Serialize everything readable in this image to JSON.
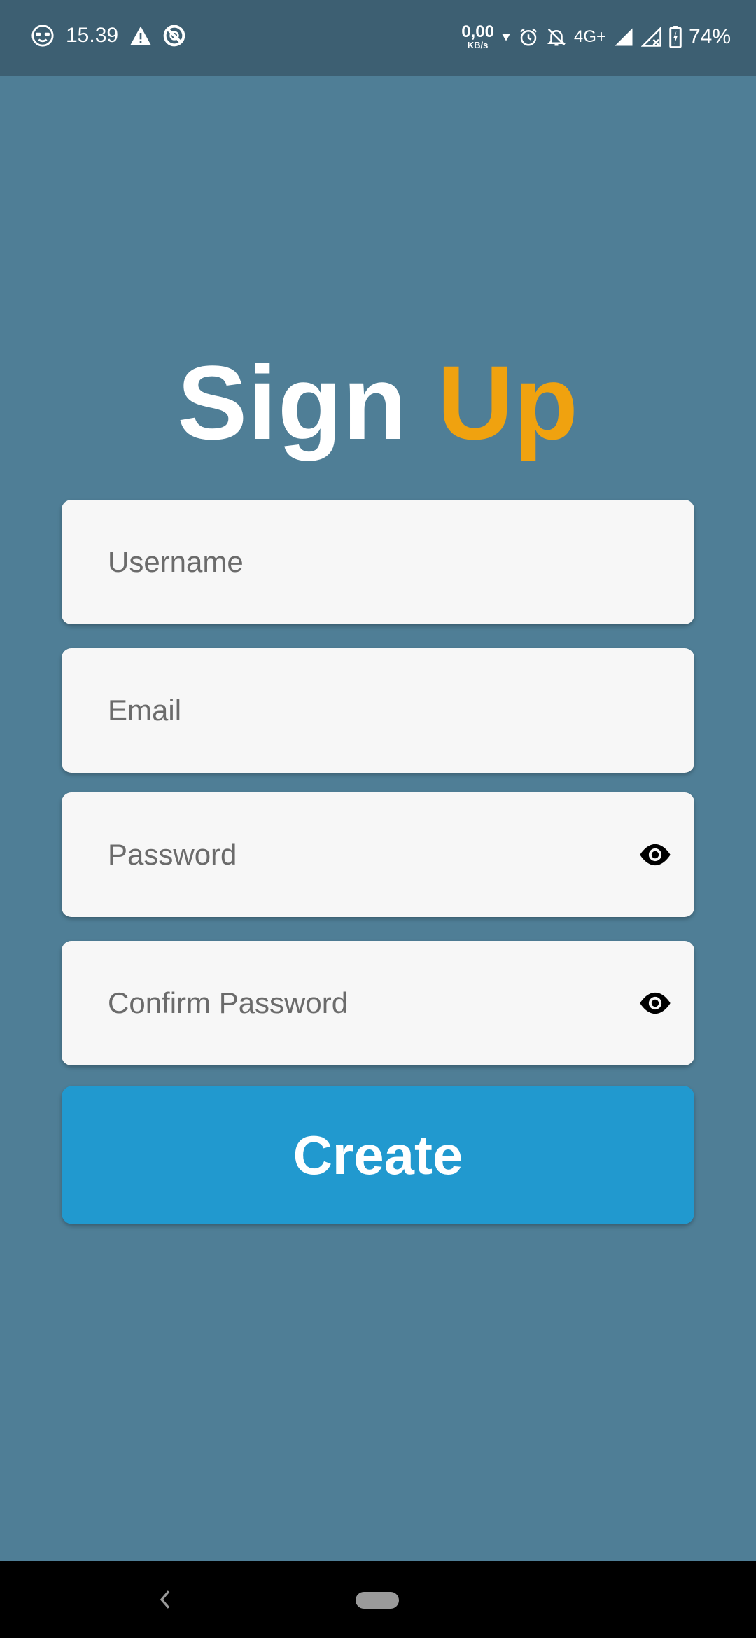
{
  "status_bar": {
    "time": "15.39",
    "net_speed_value": "0,00",
    "net_speed_unit": "KB/s",
    "network_type": "4G+",
    "battery": "74%",
    "icons": [
      "incognito-icon",
      "warning-icon",
      "no-disturb-icon",
      "data-arrow-icon",
      "alarm-icon",
      "bell-off-icon",
      "signal-icon",
      "signal-off-icon",
      "battery-charging-icon"
    ]
  },
  "title": {
    "word1": "Sign",
    "word2": "Up",
    "word1_color": "#ffffff",
    "word2_color": "#f0a20f"
  },
  "form": {
    "username_placeholder": "Username",
    "email_placeholder": "Email",
    "password_placeholder": "Password",
    "confirm_password_placeholder": "Confirm Password",
    "toggle_icon": "eye-icon"
  },
  "create_button": {
    "label": "Create",
    "color": "#2199cf"
  },
  "colors": {
    "background": "#4f7e96",
    "status_bar": "#3d5f72",
    "field_background": "#f7f7f7"
  }
}
